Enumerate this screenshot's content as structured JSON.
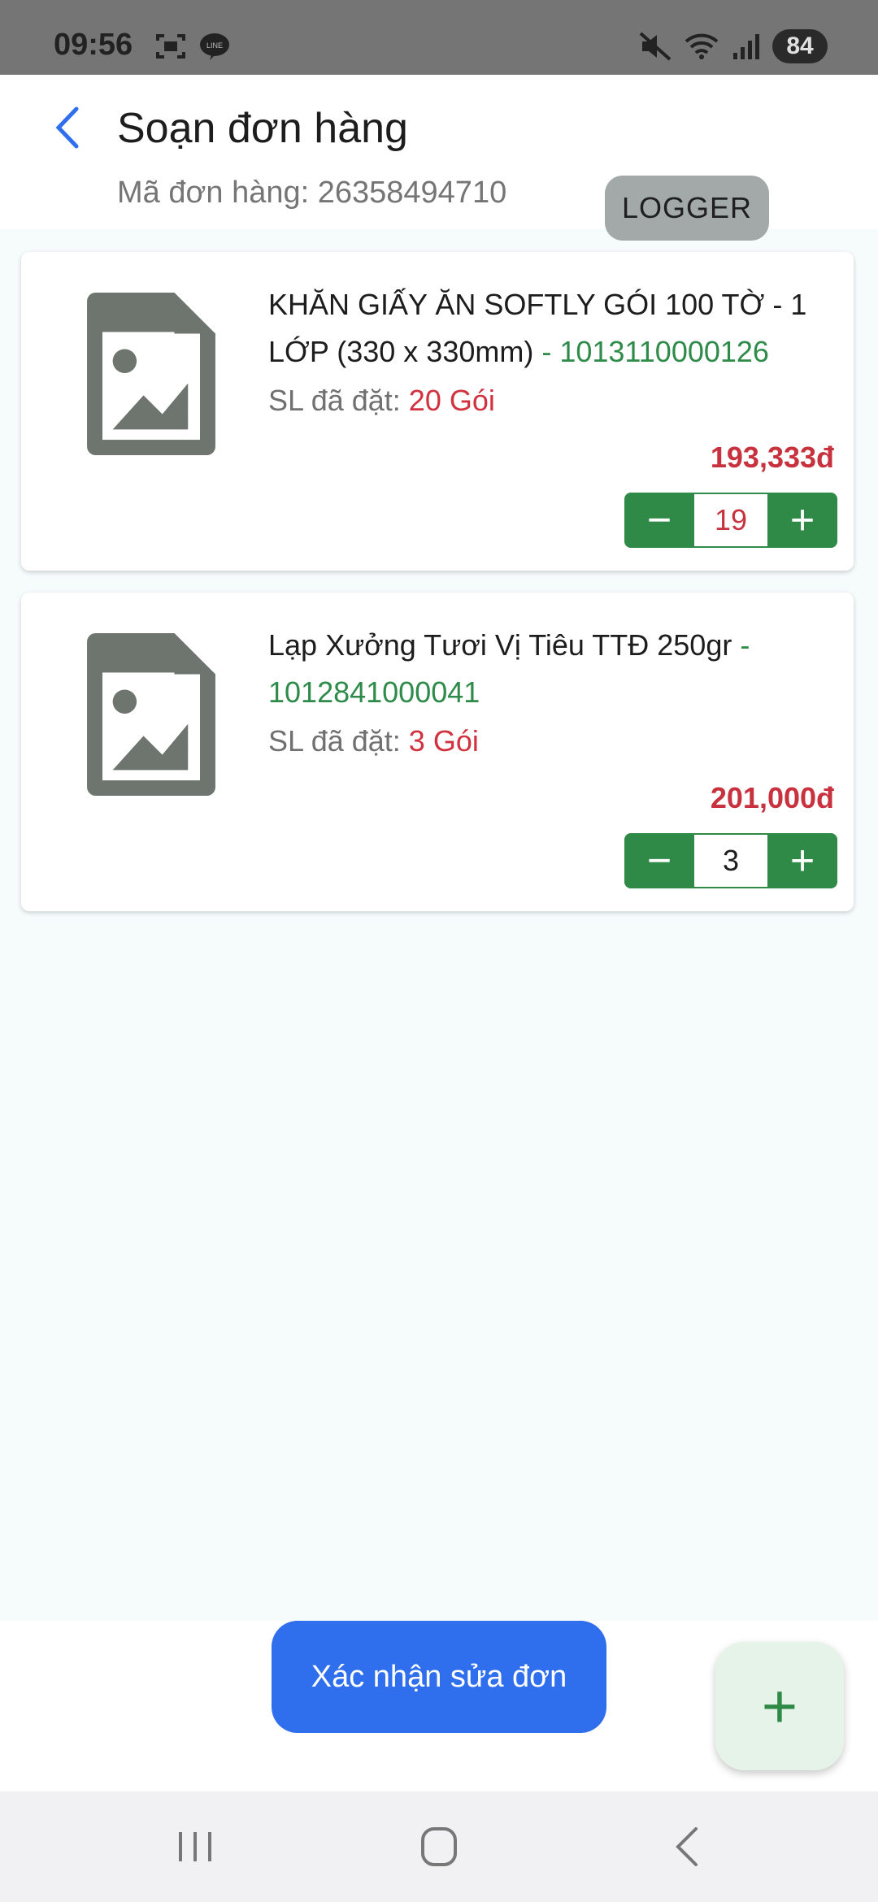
{
  "status_bar": {
    "time": "09:56",
    "battery": "84",
    "left_icons": [
      "screenshot-icon",
      "line-app-icon"
    ],
    "right_icons": [
      "mute-icon",
      "wifi-icon",
      "signal-icon"
    ]
  },
  "header": {
    "title": "Soạn đơn hàng",
    "order_code": "Mã đơn hàng: 26358494710",
    "logger_label": "LOGGER"
  },
  "items": [
    {
      "name": "KHĂN GIẤY ĂN SOFTLY GÓI 100 TỜ - 1 LỚP (330 x 330mm)",
      "sku": " - 1013110000126",
      "qty_label": "SL đã đặt: ",
      "qty_value": "20 Gói",
      "price": "193,333đ",
      "stepper_value": "19",
      "minus": "−",
      "plus": "+"
    },
    {
      "name": "Lạp Xưởng Tươi Vị Tiêu TTĐ 250gr",
      "sku": " - 1012841000041",
      "qty_label": "SL đã đặt: ",
      "qty_value": "3 Gói",
      "price": "201,000đ",
      "stepper_value": "3",
      "minus": "−",
      "plus": "+"
    }
  ],
  "footer": {
    "confirm_label": "Xác nhận sửa đơn",
    "fab_label": "+"
  },
  "colors": {
    "accent_green": "#2f8a47",
    "accent_blue": "#2f6fed",
    "price_red": "#c8323e"
  }
}
